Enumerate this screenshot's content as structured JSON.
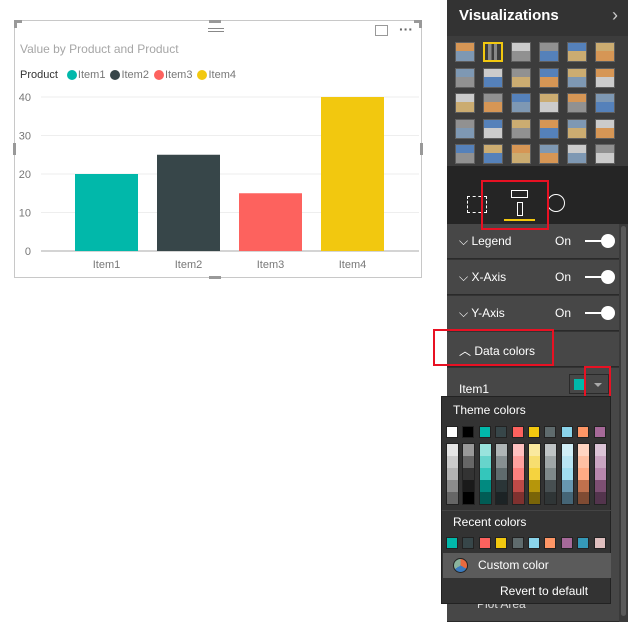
{
  "chart_card": {
    "title": "Value by Product and Product",
    "legend_title": "Product",
    "more_label": "···"
  },
  "chart_data": {
    "type": "bar",
    "title": "Value by Product and Product",
    "categories": [
      "Item1",
      "Item2",
      "Item3",
      "Item4"
    ],
    "values": [
      20,
      25,
      15,
      40
    ],
    "colors": [
      "#01B8AA",
      "#374649",
      "#FD625E",
      "#F2C80F"
    ],
    "legend_title": "Product",
    "legend_placement": "top-left",
    "ylim": [
      0,
      40
    ],
    "yticks": [
      0,
      10,
      20,
      30,
      40
    ],
    "grid": true
  },
  "panel": {
    "title": "Visualizations",
    "more": "...",
    "sections": [
      {
        "label": "Legend",
        "state": "On"
      },
      {
        "label": "X-Axis",
        "state": "On"
      },
      {
        "label": "Y-Axis",
        "state": "On"
      }
    ],
    "data_colors": {
      "label": "Data colors",
      "item_label": "Item1",
      "item_color": "#01B8AA"
    },
    "behind_label": "Plot Area"
  },
  "color_picker": {
    "theme_label": "Theme colors",
    "recent_label": "Recent colors",
    "custom_label": "Custom color",
    "revert_label": "Revert to default",
    "theme_colors": [
      "#FFFFFF",
      "#000000",
      "#01B8AA",
      "#374649",
      "#FD625E",
      "#F2C80F",
      "#5F6B6D",
      "#8AD4EB",
      "#FE9666",
      "#A66999"
    ],
    "theme_shades": [
      [
        "#e6e6e6",
        "#cccccc",
        "#b3b3b3",
        "#8c8c8c",
        "#666666"
      ],
      [
        "#999999",
        "#666666",
        "#333333",
        "#1a1a1a",
        "#000000"
      ],
      [
        "#99e3dd",
        "#67d4cc",
        "#34c6bb",
        "#018a80",
        "#015c55"
      ],
      [
        "#afb5b6",
        "#879092",
        "#5f6b6d",
        "#2a3537",
        "#1c2325"
      ],
      [
        "#fec0bf",
        "#fea19e",
        "#fd817e",
        "#be4a47",
        "#7f312f"
      ],
      [
        "#fae99f",
        "#f7de6f",
        "#f5d33f",
        "#b6960b",
        "#796408"
      ],
      [
        "#bfc4c5",
        "#9fa6a7",
        "#7f898a",
        "#474f51",
        "#2f3536"
      ],
      [
        "#d0eef7",
        "#b9e5f3",
        "#a1ddef",
        "#6897b0",
        "#456576"
      ],
      [
        "#ffd5c2",
        "#fec0a3",
        "#feab85",
        "#bf714d",
        "#7f4b33"
      ],
      [
        "#dbc3d6",
        "#caa5c2",
        "#b887ad",
        "#7d4f73",
        "#53344d"
      ]
    ],
    "recent_colors": [
      "#01B8AA",
      "#374649",
      "#FD625E",
      "#F2C80F",
      "#5F6B6D",
      "#8AD4EB",
      "#FE9666",
      "#A66999",
      "#3599B8",
      "#DFBFBF"
    ]
  }
}
